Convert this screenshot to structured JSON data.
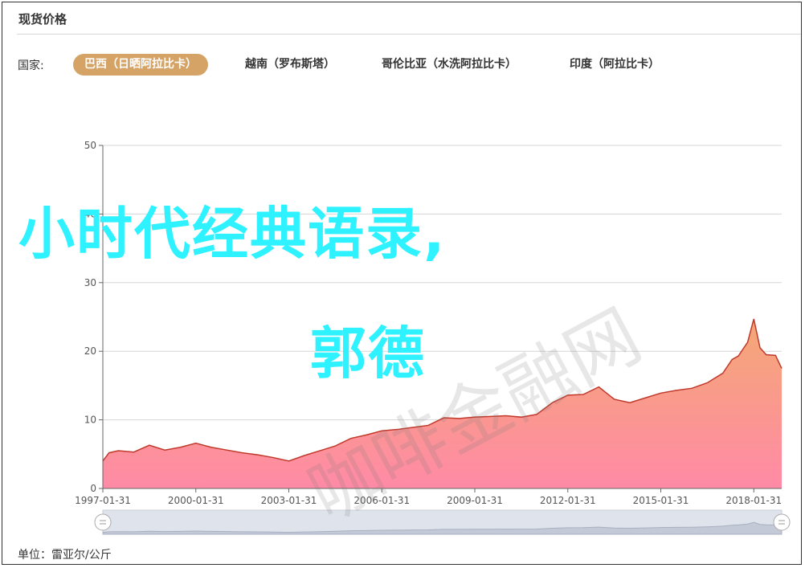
{
  "header": {
    "title": "现货价格"
  },
  "filter": {
    "label": "国家:",
    "tabs": [
      {
        "label": "巴西（日晒阿拉比卡）",
        "active": true
      },
      {
        "label": "越南（罗布斯塔）",
        "active": false
      },
      {
        "label": "哥伦比亚（水洗阿拉比卡）",
        "active": false
      },
      {
        "label": "印度（阿拉比卡）",
        "active": false
      }
    ]
  },
  "unit_label": "单位：雷亚尔/公斤",
  "overlay_text": {
    "line1": "小时代经典语录,",
    "line2": "郭德"
  },
  "watermark_text": "咖啡金融网",
  "colors": {
    "accent": "#d4a365",
    "line": "#c0392b",
    "area_top": "#f4a875",
    "area_bottom": "#ff8aa6",
    "overlay": "#2ef2ff"
  },
  "chart_data": {
    "type": "area",
    "xlabel": "",
    "ylabel": "",
    "ylim": [
      0,
      50
    ],
    "yticks": [
      0,
      10,
      20,
      30,
      40,
      50
    ],
    "xlim": [
      1997.0,
      2018.9
    ],
    "xtick_labels": [
      "1997-01-31",
      "2000-01-31",
      "2003-01-31",
      "2006-01-31",
      "2009-01-31",
      "2012-01-31",
      "2015-01-31",
      "2018-01-31"
    ],
    "grid": true,
    "series": [
      {
        "x": [
          1997.0,
          1997.2,
          1997.5,
          1998.0,
          1998.5,
          1999.0,
          1999.5,
          2000.0,
          2000.5,
          2001.0,
          2001.5,
          2002.0,
          2002.5,
          2003.0,
          2003.5,
          2004.0,
          2004.5,
          2005.0,
          2005.5,
          2006.0,
          2006.5,
          2007.0,
          2007.5,
          2008.0,
          2008.5,
          2009.0,
          2009.5,
          2010.0,
          2010.5,
          2011.0,
          2011.5,
          2012.0,
          2012.5,
          2013.0,
          2013.5,
          2014.0,
          2014.5,
          2015.0,
          2015.5,
          2016.0,
          2016.5,
          2017.0,
          2017.3,
          2017.5,
          2017.8,
          2018.0,
          2018.2,
          2018.4,
          2018.7,
          2018.9
        ],
        "y": [
          4.0,
          5.2,
          5.5,
          5.3,
          6.3,
          5.6,
          6.0,
          6.6,
          6.0,
          5.6,
          5.2,
          4.9,
          4.5,
          4.0,
          4.8,
          5.5,
          6.2,
          7.3,
          7.8,
          8.4,
          8.6,
          8.9,
          9.2,
          10.3,
          10.2,
          10.4,
          10.5,
          10.6,
          10.4,
          10.8,
          12.5,
          13.6,
          13.7,
          14.8,
          13.0,
          12.5,
          13.2,
          13.9,
          14.3,
          14.6,
          15.4,
          16.8,
          18.8,
          19.3,
          21.3,
          24.7,
          20.5,
          19.5,
          19.4,
          17.5
        ]
      }
    ]
  }
}
